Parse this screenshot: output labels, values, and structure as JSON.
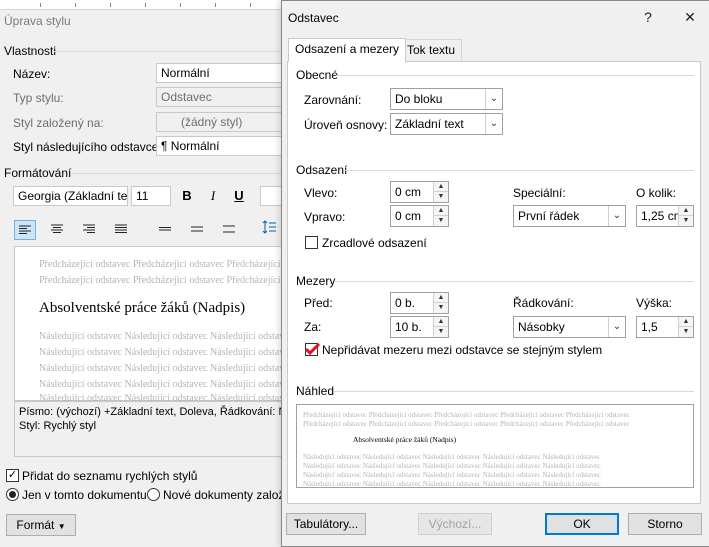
{
  "style_window": {
    "title": "Úprava stylu",
    "properties": {
      "group_label": "Vlastnosti",
      "name_label": "Název:",
      "name_value": "Normální",
      "style_type_label": "Typ stylu:",
      "style_type_value": "Odstavec",
      "based_on_label": "Styl založený na:",
      "based_on_value": "(žádný styl)",
      "next_style_label": "Styl následujícího odstavce:",
      "next_style_value": "Normální",
      "next_style_glyph": "¶"
    },
    "formatting": {
      "group_label": "Formátování",
      "font_value": "Georgia (Základní te",
      "size_value": "11",
      "bold_label": "B",
      "italic_label": "I",
      "underline_label": "U"
    },
    "preview": {
      "prev_line_1": "Předcházející odstavec Předcházející odstavec Předcházející odstavec",
      "prev_line_2": "Předcházející odstavec Předcházející odstavec Předcházející odstavec",
      "heading": "Absolventské práce žáků (Nadpis)",
      "next_line_1": "Následující odstavec Následující odstavec Následující odstavec",
      "next_line_2": "Následující odstavec Následující odstavec Následující odstavec",
      "next_line_3": "Následující odstavec Následující odstavec Následující odstavec",
      "next_line_4": "Následující odstavec Následující odstavec Následující odstavec",
      "next_line_5": "Následující odstavec Následující odstavec Následující odstavec"
    },
    "description_line_1": "Písmo: (výchozí) +Základní text, Doleva, Řádkování:  N",
    "description_line_2": "Styl: Rychlý styl",
    "add_to_gallery_label": "Přidat do seznamu rychlých stylů",
    "add_to_gallery_checked": true,
    "only_this_doc_label": "Jen v tomto dokumentu",
    "new_docs_label": "Nové dokumenty založ",
    "format_button_label": "Formát"
  },
  "paragraph_dialog": {
    "title": "Odstavec",
    "help_glyph": "?",
    "close_glyph": "✕",
    "tabs": [
      {
        "label": "Odsazení a mezery",
        "active": true
      },
      {
        "label": "Tok textu",
        "active": false
      }
    ],
    "general": {
      "group_label": "Obecné",
      "alignment_label": "Zarovnání:",
      "alignment_value": "Do bloku",
      "outline_label": "Úroveň osnovy:",
      "outline_value": "Základní text"
    },
    "indentation": {
      "group_label": "Odsazení",
      "left_label": "Vlevo:",
      "left_value": "0 cm",
      "right_label": "Vpravo:",
      "right_value": "0 cm",
      "special_label": "Speciální:",
      "special_value": "První řádek",
      "by_label": "O kolik:",
      "by_value": "1,25 cm",
      "mirror_label": "Zrcadlové odsazení",
      "mirror_checked": false
    },
    "spacing": {
      "group_label": "Mezery",
      "before_label": "Před:",
      "before_value": "0 b.",
      "after_label": "Za:",
      "after_value": "10 b.",
      "line_spacing_label": "Řádkování:",
      "line_spacing_value": "Násobky",
      "at_label": "Výška:",
      "at_value": "1,5",
      "dont_add_space_label": "Nepřidávat mezeru mezi odstavce se stejným stylem",
      "dont_add_space_checked": true
    },
    "preview": {
      "group_label": "Náhled",
      "prev_line_1": "Předcházející odstavec Předcházející odstavec Předcházející odstavec Předcházející odstavec Předcházející odstavec",
      "prev_line_2": "Předcházející odstavec Předcházející odstavec Předcházející odstavec Předcházející odstavec Předcházející odstavec",
      "heading": "Absolventské práce žáků (Nadpis)",
      "next_line_1": "Následující odstavec Následující odstavec Následující odstavec Následující odstavec Následující odstavec",
      "next_line_2": "Následující odstavec Následující odstavec Následující odstavec Následující odstavec Následující odstavec",
      "next_line_3": "Následující odstavec Následující odstavec Následující odstavec Následující odstavec Následující odstavec",
      "next_line_4": "Následující odstavec Následující odstavec Následující odstavec Následující odstavec Následující odstavec"
    },
    "buttons": {
      "tabs_label": "Tabulátory...",
      "default_label": "Výchozí...",
      "ok_label": "OK",
      "cancel_label": "Storno"
    }
  },
  "colors": {
    "accent": "#0078d7",
    "checkbox_mark": "#e81123",
    "pressed_bg": "#cce4f7"
  }
}
